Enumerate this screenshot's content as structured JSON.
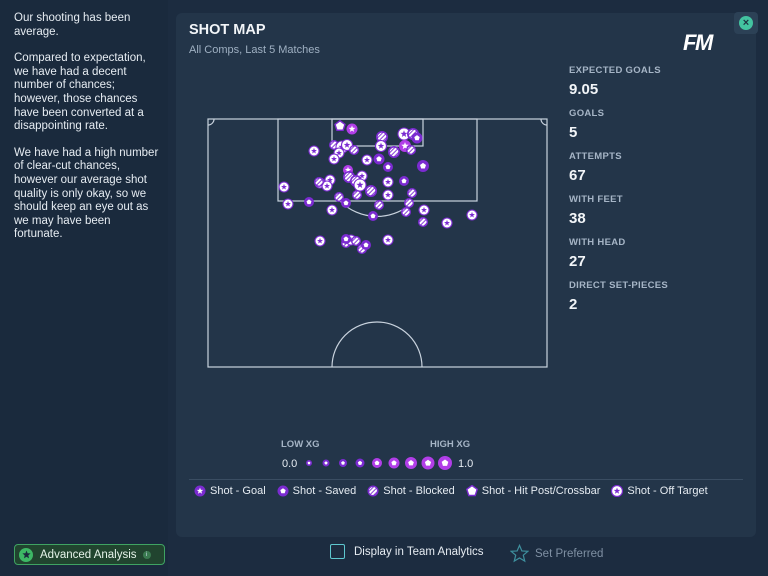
{
  "sidebar": {
    "paragraphs": [
      "Our shooting has been average.",
      "Compared to expectation, we have had a decent number of chances; however, those chances have been converted at a disappointing rate.",
      "We have had a high number of clear-cut chances, however our average shot quality is only okay, so we should keep an eye out as we may have been fortunate."
    ],
    "advanced_analysis_label": "Advanced Analysis"
  },
  "panel": {
    "title": "SHOT MAP",
    "subtitle": "All Comps, Last 5 Matches",
    "logo": "FM"
  },
  "stats": [
    {
      "label": "EXPECTED GOALS",
      "value": "9.05"
    },
    {
      "label": "GOALS",
      "value": "5"
    },
    {
      "label": "ATTEMPTS",
      "value": "67"
    },
    {
      "label": "WITH FEET",
      "value": "38"
    },
    {
      "label": "WITH HEAD",
      "value": "27"
    },
    {
      "label": "DIRECT SET-PIECES",
      "value": "2"
    }
  ],
  "xg_scale": {
    "low_label": "LOW XG",
    "high_label": "HIGH XG",
    "min": "0.0",
    "max": "1.0"
  },
  "legend": [
    {
      "icon": "goal-star-icon",
      "label": "Shot - Goal"
    },
    {
      "icon": "saved-pentagon-icon",
      "label": "Shot - Saved"
    },
    {
      "icon": "blocked-hatched-icon",
      "label": "Shot - Blocked"
    },
    {
      "icon": "post-pentagon-icon",
      "label": "Shot - Hit Post/Crossbar"
    },
    {
      "icon": "off-target-star-icon",
      "label": "Shot - Off Target"
    }
  ],
  "bottom": {
    "display_label": "Display in Team Analytics",
    "preferred_label": "Set Preferred"
  },
  "colors": {
    "accent_purple": "#7b2bd1",
    "bright_purple": "#b13ee8",
    "background": "#1c2c40",
    "panel": "#233549",
    "green": "#3db865",
    "teal": "#43c3a0"
  }
}
